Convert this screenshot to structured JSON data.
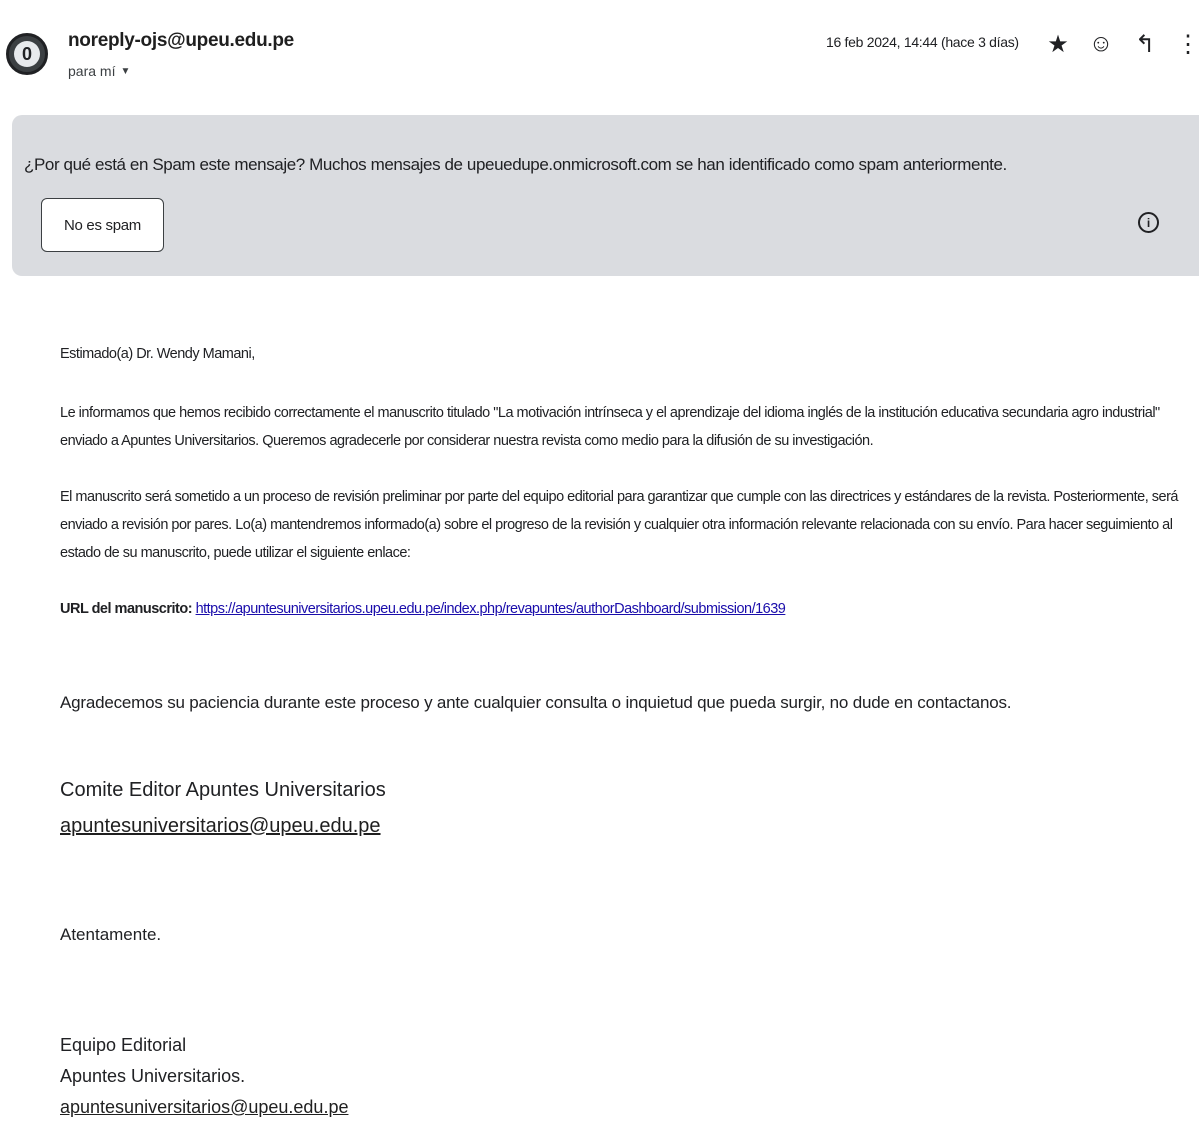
{
  "header": {
    "avatar_glyph": "0",
    "sender": "noreply-ojs@upeu.edu.pe",
    "recipient": "para mí",
    "date": "16 feb 2024, 14:44 (hace 3 días)",
    "icons": [
      "star-icon",
      "emoji-icon",
      "reply-icon",
      "more-vert-icon"
    ],
    "icon_glyphs": {
      "star": "★",
      "emoji": "☺",
      "reply": "↰",
      "more": "⋮"
    }
  },
  "spam_banner": {
    "message": "¿Por qué está en Spam este mensaje? Muchos mensajes de upeuedupe.onmicrosoft.com se han identificado como spam anteriormente.",
    "not_spam_button": "No es spam",
    "info_glyph": "i"
  },
  "body": {
    "greeting": "Estimado(a) Dr. Wendy Mamani,",
    "paragraph1": "Le informamos que hemos recibido correctamente el manuscrito titulado \"La motivación intrínseca y el aprendizaje del idioma inglés de la institución educativa secundaria agro industrial\" enviado a Apuntes Universitarios. Queremos agradecerle por considerar nuestra revista como medio para la difusión de su investigación.",
    "paragraph2": "El manuscrito será sometido a un proceso de revisión preliminar por parte del equipo editorial para garantizar que cumple con las directrices y estándares de la revista. Posteriormente, será enviado a revisión por pares. Lo(a) mantendremos informado(a) sobre el progreso de la revisión y cualquier otra información relevante relacionada con su envío. Para hacer seguimiento al estado de su manuscrito, puede utilizar el siguiente enlace:",
    "url_label": "URL del manuscrito:",
    "url": "https://apuntesuniversitarios.upeu.edu.pe/index.php/revapuntes/authorDashboard/submission/1639",
    "thanks": "Agradecemos su paciencia durante este proceso y ante cualquier consulta o inquietud que pueda surgir, no dude en contactanos.",
    "committee": "Comite Editor Apuntes Universitarios",
    "committee_email": "apuntesuniversitarios@upeu.edu.pe",
    "closing": "Atentamente.",
    "team": "Equipo Editorial",
    "journal": "Apuntes Universitarios.",
    "team_email": "apuntesuniversitarios@upeu.edu.pe"
  }
}
